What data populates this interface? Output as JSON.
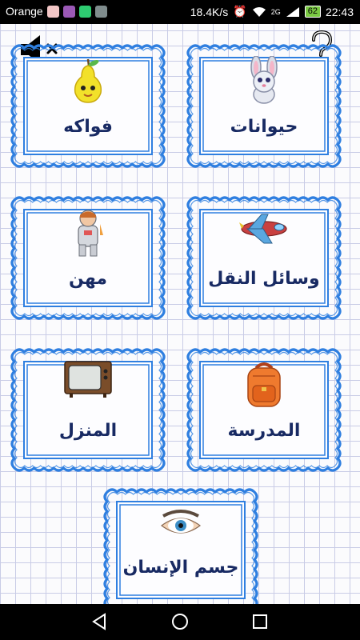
{
  "status_bar": {
    "carrier": "Orange",
    "speed": "18.4K/s",
    "network": "2G",
    "battery": "62",
    "time": "22:43",
    "app_icon_colors": [
      "#f2c6c6",
      "#9b59b6",
      "#2ecc71",
      "#7f8c8d"
    ]
  },
  "top_icons": {
    "mute": "speaker-muted-icon",
    "help": "question-mark-icon"
  },
  "categories": [
    {
      "label": "حيوانات",
      "icon": "bunny-icon"
    },
    {
      "label": "فواكه",
      "icon": "pear-icon"
    },
    {
      "label": "وسائل النقل",
      "icon": "airplane-icon"
    },
    {
      "label": "مهن",
      "icon": "astronaut-icon"
    },
    {
      "label": "المدرسة",
      "icon": "backpack-icon"
    },
    {
      "label": "المنزل",
      "icon": "tv-icon"
    },
    {
      "label": "جسم الإنسان",
      "icon": "eye-icon"
    }
  ],
  "nav": {
    "back": "back-triangle-icon",
    "home": "home-circle-icon",
    "recents": "recents-square-icon"
  },
  "colors": {
    "frame_blue": "#2f7fe0",
    "label_navy": "#182a63"
  }
}
